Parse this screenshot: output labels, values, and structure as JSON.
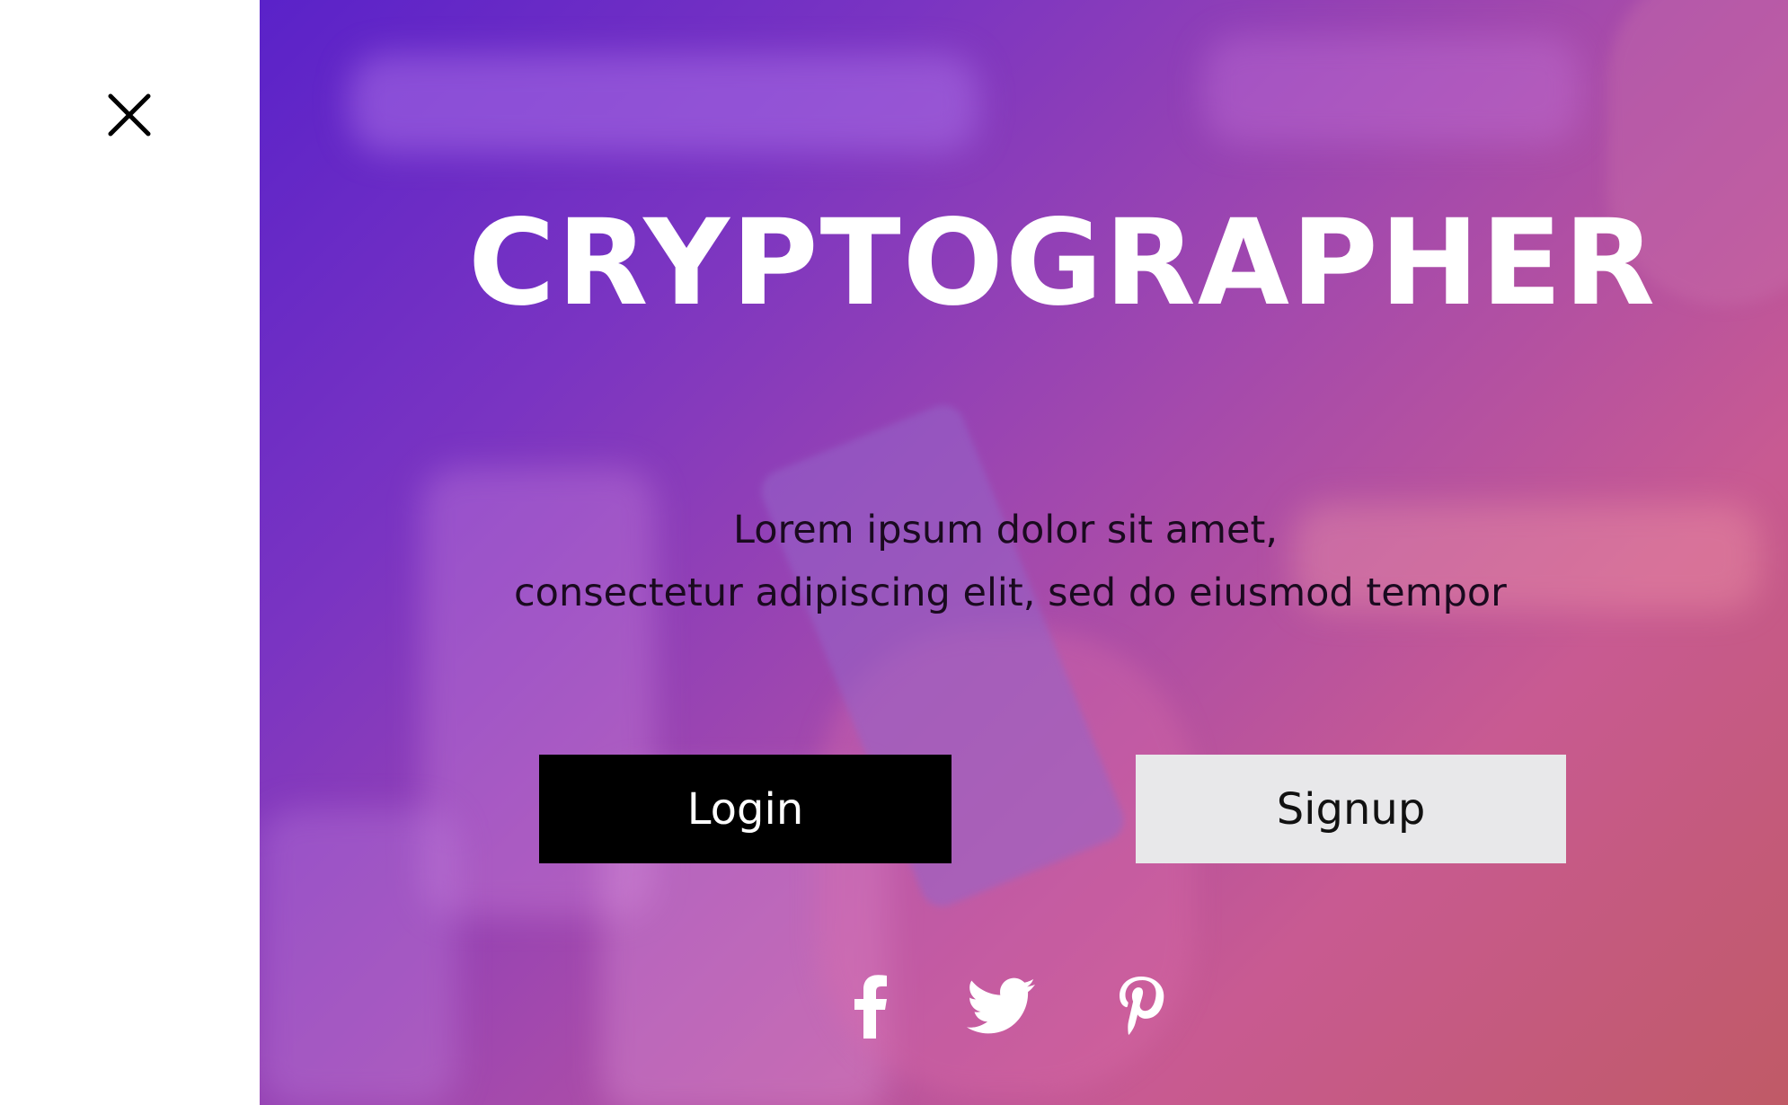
{
  "sidebar": {
    "close_icon": "close-icon"
  },
  "hero": {
    "title": "CRYPTOGRAPHER",
    "subtitle_line1": "Lorem ipsum dolor sit amet,",
    "subtitle_line2": "consectetur adipiscing elit, sed do eiusmod tempor",
    "login_label": "Login",
    "signup_label": "Signup",
    "social_icons": [
      "facebook-icon",
      "twitter-icon",
      "pinterest-icon"
    ]
  },
  "colors": {
    "login_bg": "#000000",
    "signup_bg": "#e8e8ea",
    "gradient_start": "#5a22c9",
    "gradient_end": "#c05a66"
  }
}
